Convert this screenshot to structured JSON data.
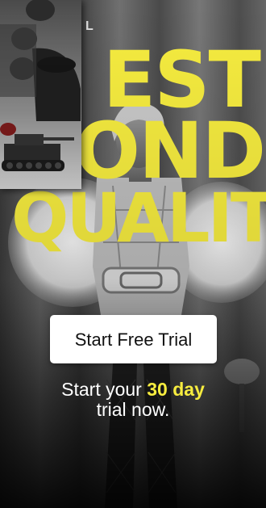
{
  "colors": {
    "accent": "#f6ec3f",
    "cta_background": "#ffffff",
    "cta_text": "#111111"
  },
  "header": {
    "corner_letter": "L"
  },
  "hero": {
    "headline_line1": "EST",
    "headline_line2": "OND",
    "headline_line3": "QUALITY"
  },
  "cta": {
    "label": "Start Free Trial"
  },
  "offer": {
    "prefix": "Start your ",
    "highlight": "30 day",
    "suffix": "trial now."
  },
  "icons": {
    "poster": "war-movie-poster-thumbnail"
  }
}
